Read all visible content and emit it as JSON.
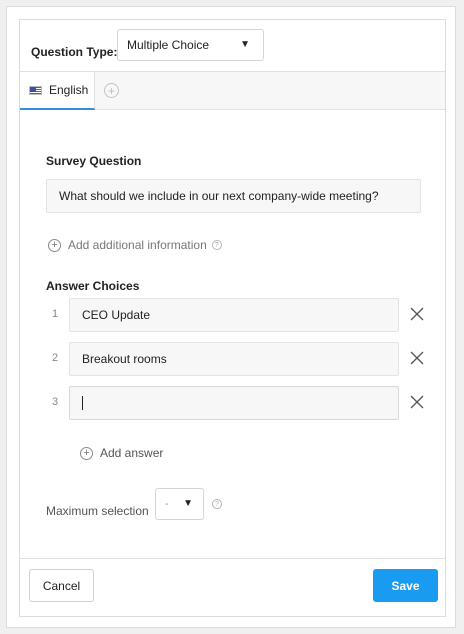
{
  "question_type": {
    "label": "Question Type:",
    "selected": "Multiple Choice",
    "caret": "▼"
  },
  "tabs": [
    {
      "label": "English",
      "icon": "us-flag-icon",
      "active": true
    }
  ],
  "add_language_icon": "+",
  "survey_question": {
    "label": "Survey Question",
    "value": "What should we include in our next company-wide meeting?"
  },
  "add_info": {
    "label": "Add additional information",
    "plus": "+",
    "help": "?"
  },
  "answers": {
    "label": "Answer Choices",
    "items": [
      {
        "number": "1",
        "value": "CEO Update"
      },
      {
        "number": "2",
        "value": "Breakout rooms"
      },
      {
        "number": "3",
        "value": ""
      }
    ],
    "add_label": "Add answer",
    "add_plus": "+"
  },
  "max_selection": {
    "label": "Maximum selection",
    "value": "-",
    "caret": "▼",
    "help": "?"
  },
  "footer": {
    "cancel_label": "Cancel",
    "save_label": "Save"
  },
  "colors": {
    "accent": "#1a9bf2",
    "tab_underline": "#2f8ee0"
  }
}
